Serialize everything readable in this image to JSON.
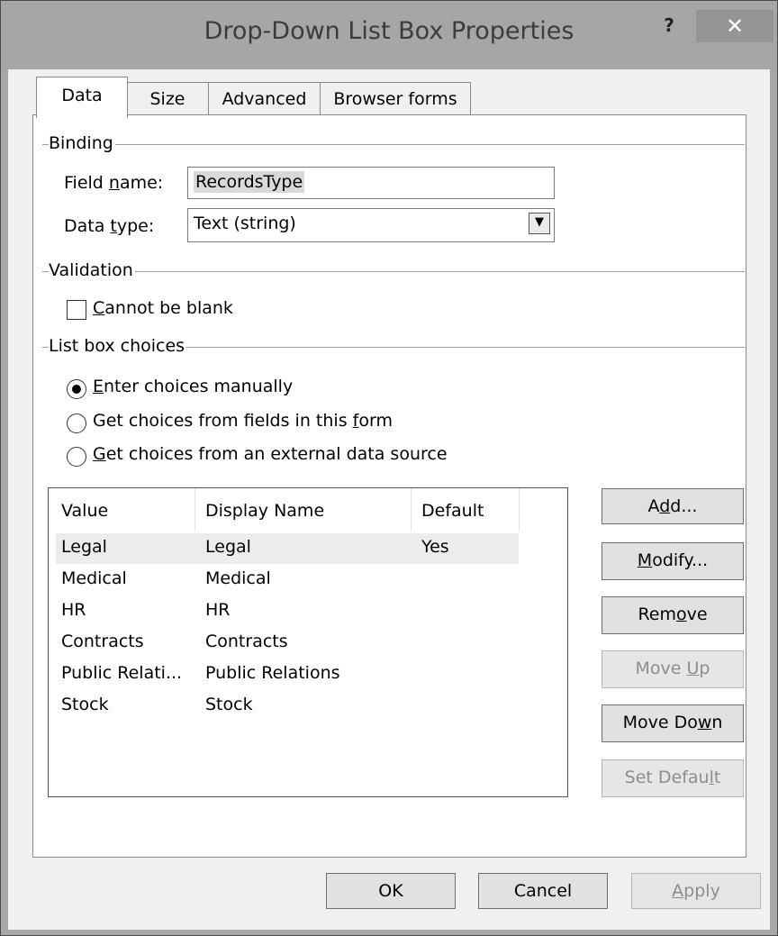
{
  "window": {
    "title": "Drop-Down List Box Properties",
    "help_label": "?",
    "close_label": "✕"
  },
  "tabs": [
    {
      "label": "Data",
      "active": true
    },
    {
      "label": "Size",
      "active": false
    },
    {
      "label": "Advanced",
      "active": false
    },
    {
      "label": "Browser forms",
      "active": false
    }
  ],
  "binding": {
    "group_title": "Binding",
    "field_name_label": "Field name:",
    "field_name_value": "RecordsType",
    "data_type_label": "Data type:",
    "data_type_value": "Text (string)"
  },
  "validation": {
    "group_title": "Validation",
    "cannot_be_blank_label": "Cannot be blank",
    "cannot_be_blank_checked": false
  },
  "list_box_choices": {
    "group_title": "List box choices",
    "options": [
      {
        "label": "Enter choices manually",
        "selected": true
      },
      {
        "label": "Get choices from fields in this form",
        "selected": false
      },
      {
        "label": "Get choices from an external data source",
        "selected": false
      }
    ],
    "columns": [
      "Value",
      "Display Name",
      "Default"
    ],
    "rows": [
      {
        "value": "Legal",
        "display": "Legal",
        "default": "Yes"
      },
      {
        "value": "Medical",
        "display": "Medical",
        "default": ""
      },
      {
        "value": "HR",
        "display": "HR",
        "default": ""
      },
      {
        "value": "Contracts",
        "display": "Contracts",
        "default": ""
      },
      {
        "value": "Public Relati...",
        "display": "Public Relations",
        "default": ""
      },
      {
        "value": "Stock",
        "display": "Stock",
        "default": ""
      }
    ],
    "buttons": {
      "add": "Add...",
      "modify": "Modify...",
      "remove": "Remove",
      "move_up": "Move Up",
      "move_down": "Move Down",
      "set_default": "Set Default"
    }
  },
  "footer": {
    "ok": "OK",
    "cancel": "Cancel",
    "apply": "Apply"
  }
}
